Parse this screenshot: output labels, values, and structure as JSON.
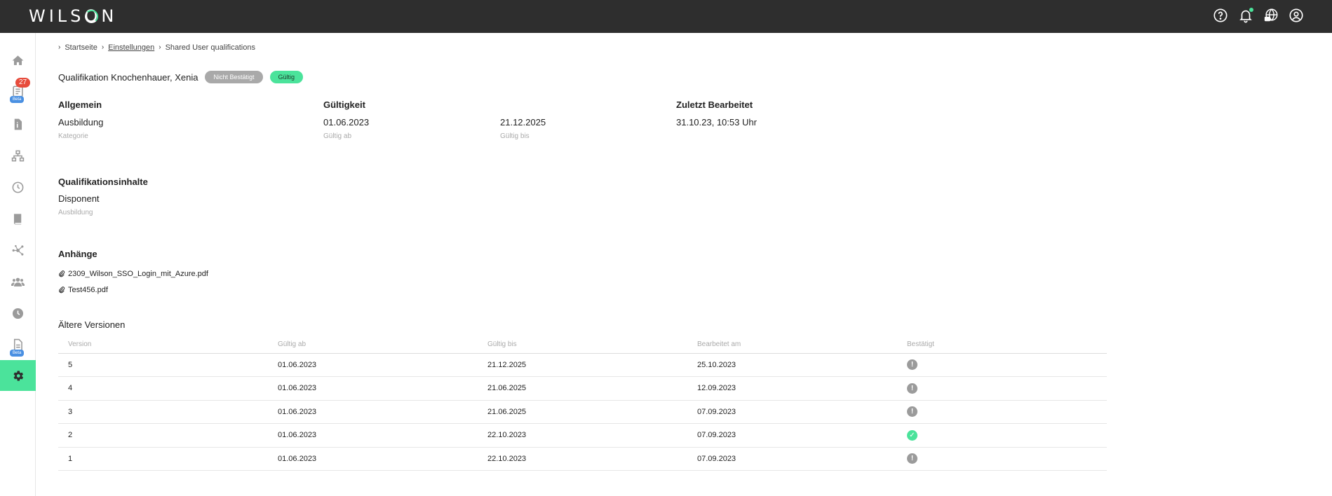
{
  "app": {
    "logo": "WILSON"
  },
  "topbar": {
    "icons": [
      "help-icon",
      "bell-icon",
      "globe-icon",
      "user-icon"
    ]
  },
  "sidebar": {
    "items": [
      {
        "icon": "home-icon"
      },
      {
        "icon": "list-icon",
        "badge": "27",
        "beta": "Beta"
      },
      {
        "icon": "document-icon"
      },
      {
        "icon": "hierarchy-icon"
      },
      {
        "icon": "clock-icon"
      },
      {
        "icon": "book-icon"
      },
      {
        "icon": "network-icon"
      },
      {
        "icon": "users-icon"
      },
      {
        "icon": "history-icon"
      },
      {
        "icon": "report-icon",
        "beta": "Beta"
      },
      {
        "icon": "gear-icon",
        "active": true
      }
    ]
  },
  "breadcrumb": {
    "items": [
      "Startseite",
      "Einstellungen",
      "Shared User qualifications"
    ]
  },
  "header": {
    "title": "Qualifikation Knochenhauer, Xenia",
    "status_unconfirmed": "Nicht Bestätigt",
    "status_valid": "Gültig"
  },
  "general": {
    "heading": "Allgemein",
    "category_value": "Ausbildung",
    "category_label": "Kategorie"
  },
  "validity": {
    "heading": "Gültigkeit",
    "from_value": "01.06.2023",
    "from_label": "Gültig ab",
    "to_value": "21.12.2025",
    "to_label": "Gültig bis"
  },
  "last_edited": {
    "heading": "Zuletzt Bearbeitet",
    "value": "31.10.23, 10:53 Uhr"
  },
  "contents": {
    "heading": "Qualifikationsinhalte",
    "value": "Disponent",
    "label": "Ausbildung"
  },
  "attachments": {
    "heading": "Anhänge",
    "files": [
      "2309_Wilson_SSO_Login_mit_Azure.pdf",
      "Test456.pdf"
    ]
  },
  "older_versions": {
    "heading": "Ältere Versionen",
    "columns": [
      "Version",
      "Gültig ab",
      "Gültig bis",
      "Bearbeitet am",
      "Bestätigt"
    ],
    "rows": [
      {
        "version": "5",
        "from": "01.06.2023",
        "to": "21.12.2025",
        "edited": "25.10.2023",
        "confirmed": false
      },
      {
        "version": "4",
        "from": "01.06.2023",
        "to": "21.06.2025",
        "edited": "12.09.2023",
        "confirmed": false
      },
      {
        "version": "3",
        "from": "01.06.2023",
        "to": "21.06.2025",
        "edited": "07.09.2023",
        "confirmed": false
      },
      {
        "version": "2",
        "from": "01.06.2023",
        "to": "22.10.2023",
        "edited": "07.09.2023",
        "confirmed": true
      },
      {
        "version": "1",
        "from": "01.06.2023",
        "to": "22.10.2023",
        "edited": "07.09.2023",
        "confirmed": false
      }
    ]
  },
  "colors": {
    "accent": "#4be39b",
    "topbar": "#2e2e2e",
    "badge": "#e74c3c",
    "beta": "#4a90e2"
  }
}
